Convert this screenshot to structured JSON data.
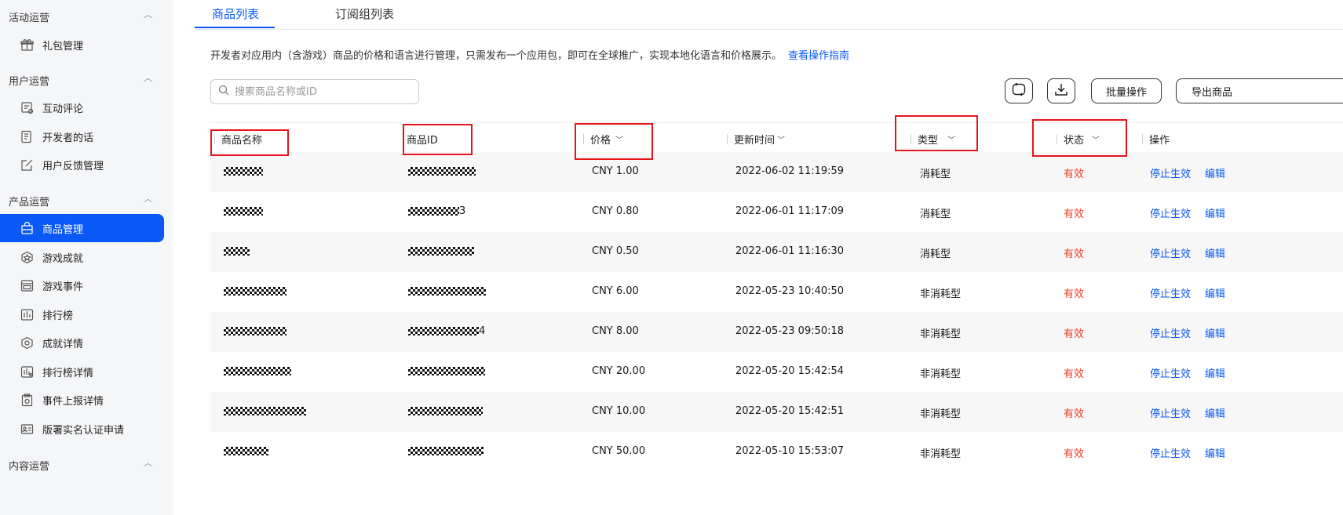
{
  "sidebar": {
    "groups": [
      {
        "label": "活动运营",
        "items": [
          {
            "label": "礼包管理",
            "icon": "gift-icon"
          }
        ]
      },
      {
        "label": "用户运营",
        "items": [
          {
            "label": "互动评论",
            "icon": "comment-icon"
          },
          {
            "label": "开发者的话",
            "icon": "note-icon"
          },
          {
            "label": "用户反馈管理",
            "icon": "edit-icon"
          }
        ]
      },
      {
        "label": "产品运营",
        "items": [
          {
            "label": "商品管理",
            "icon": "bag-icon",
            "active": true
          },
          {
            "label": "游戏成就",
            "icon": "badge-icon"
          },
          {
            "label": "游戏事件",
            "icon": "calendar-icon"
          },
          {
            "label": "排行榜",
            "icon": "chart-icon"
          },
          {
            "label": "成就详情",
            "icon": "gear-badge-icon"
          },
          {
            "label": "排行榜详情",
            "icon": "chart-detail-icon"
          },
          {
            "label": "事件上报详情",
            "icon": "clipboard-icon"
          },
          {
            "label": "版署实名认证申请",
            "icon": "id-card-icon"
          }
        ]
      },
      {
        "label": "内容运营",
        "items": []
      }
    ]
  },
  "tabs": [
    {
      "label": "商品列表",
      "active": true
    },
    {
      "label": "订阅组列表"
    }
  ],
  "description": {
    "text": "开发者对应用内（含游戏）商品的价格和语言进行管理，只需发布一个应用包，即可在全球推广，实现本地化语言和价格展示。",
    "link": "查看操作指南"
  },
  "search": {
    "placeholder": "搜索商品名称或ID"
  },
  "toolbar": {
    "batch_label": "批量操作",
    "export_label": "导出商品"
  },
  "table": {
    "columns": {
      "name": "商品名称",
      "id": "商品ID",
      "price": "价格",
      "updated": "更新时间",
      "type": "类型",
      "status": "状态",
      "actions": "操作"
    },
    "rows": [
      {
        "price": "CNY 1.00",
        "updated": "2022-06-02 11:19:59",
        "type": "消耗型",
        "status": "有效",
        "stop": "停止生效",
        "edit": "编辑",
        "id_suffix": ""
      },
      {
        "price": "CNY 0.80",
        "updated": "2022-06-01 11:17:09",
        "type": "消耗型",
        "status": "有效",
        "stop": "停止生效",
        "edit": "编辑",
        "id_suffix": "3"
      },
      {
        "price": "CNY 0.50",
        "updated": "2022-06-01 11:16:30",
        "type": "消耗型",
        "status": "有效",
        "stop": "停止生效",
        "edit": "编辑",
        "id_suffix": ""
      },
      {
        "price": "CNY 6.00",
        "updated": "2022-05-23 10:40:50",
        "type": "非消耗型",
        "status": "有效",
        "stop": "停止生效",
        "edit": "编辑",
        "id_suffix": ""
      },
      {
        "price": "CNY 8.00",
        "updated": "2022-05-23 09:50:18",
        "type": "非消耗型",
        "status": "有效",
        "stop": "停止生效",
        "edit": "编辑",
        "id_suffix": "4"
      },
      {
        "price": "CNY 20.00",
        "updated": "2022-05-20 15:42:54",
        "type": "非消耗型",
        "status": "有效",
        "stop": "停止生效",
        "edit": "编辑",
        "id_suffix": ""
      },
      {
        "price": "CNY 10.00",
        "updated": "2022-05-20 15:42:51",
        "type": "非消耗型",
        "status": "有效",
        "stop": "停止生效",
        "edit": "编辑",
        "id_suffix": ""
      },
      {
        "price": "CNY 50.00",
        "updated": "2022-05-10 15:53:07",
        "type": "非消耗型",
        "status": "有效",
        "stop": "停止生效",
        "edit": "编辑",
        "id_suffix": ""
      }
    ]
  },
  "colors": {
    "accent": "#0a59f7",
    "status_valid": "#e84026",
    "annotation_box": "#e8141c"
  }
}
